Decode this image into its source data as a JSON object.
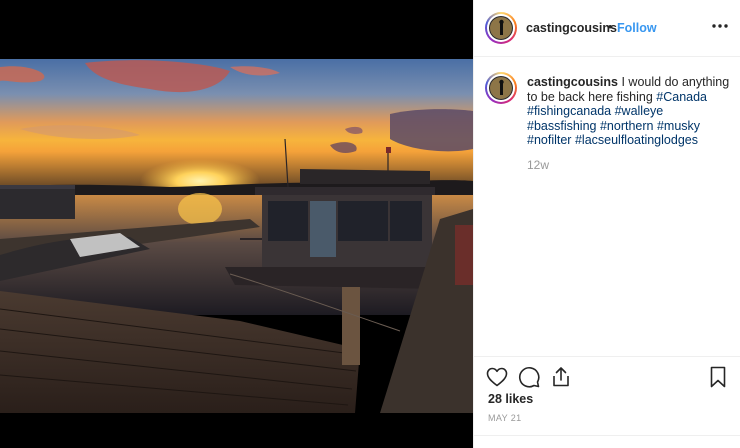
{
  "post": {
    "username": "castingcousins",
    "separator": "•",
    "follow_label": "Follow",
    "more_icon": "more-horizontal-icon"
  },
  "caption": {
    "username": "castingcousins",
    "text": "I would do anything to be back here fishing",
    "hashtags": [
      "#Canada",
      "#fishingcanada",
      "#walleye",
      "#bassfishing",
      "#northern",
      "#musky",
      "#nofilter",
      "#lacseulfloatinglodges"
    ],
    "time_ago": "12w"
  },
  "actions": {
    "like_icon": "heart-icon",
    "comment_icon": "comment-icon",
    "share_icon": "share-icon",
    "save_icon": "bookmark-icon"
  },
  "stats": {
    "likes": "28 likes",
    "date": "MAY 21"
  },
  "colors": {
    "follow": "#3897f0",
    "hashtag": "#003569",
    "muted": "#999999",
    "text": "#262626"
  }
}
